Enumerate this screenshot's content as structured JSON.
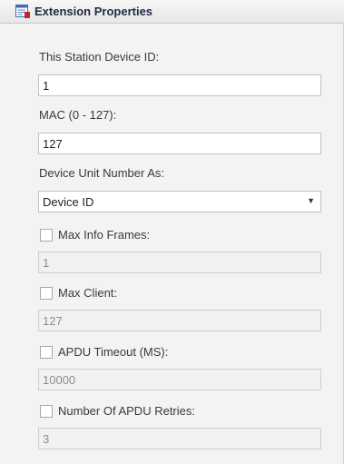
{
  "header": {
    "title": "Extension Properties",
    "icon": "properties-grid-icon"
  },
  "fields": {
    "station_device_id": {
      "label": "This Station Device ID:",
      "value": "1"
    },
    "mac": {
      "label": "MAC (0 - 127):",
      "value": "127"
    },
    "device_unit_number": {
      "label": "Device Unit Number As:",
      "selected": "Device ID"
    },
    "max_info_frames": {
      "label": "Max Info Frames:",
      "checked": false,
      "value": "1"
    },
    "max_client": {
      "label": "Max Client:",
      "checked": false,
      "value": "127"
    },
    "apdu_timeout": {
      "label": "APDU Timeout (MS):",
      "checked": false,
      "value": "10000"
    },
    "apdu_retries": {
      "label": "Number Of APDU Retries:",
      "checked": false,
      "value": "3"
    }
  },
  "colors": {
    "background": "#f3f3f3",
    "header_text": "#1f2a44",
    "icon_red": "#cc2222",
    "icon_blue": "#3a6fb3"
  }
}
